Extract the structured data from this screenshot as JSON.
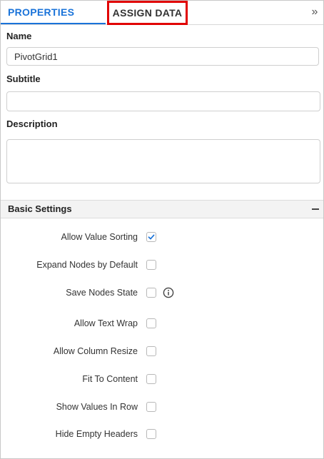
{
  "tabs": {
    "properties": "PROPERTIES",
    "assign_data": "ASSIGN DATA",
    "collapse_icon": "double-chevron-right-icon"
  },
  "fields": {
    "name_label": "Name",
    "name_value": "PivotGrid1",
    "subtitle_label": "Subtitle",
    "subtitle_value": "",
    "description_label": "Description",
    "description_value": ""
  },
  "basic_settings": {
    "title": "Basic Settings",
    "collapse_icon": "minus-icon",
    "items": [
      {
        "label": "Allow Value Sorting",
        "checked": true
      },
      {
        "label": "Expand Nodes by Default",
        "checked": false
      },
      {
        "label": "Save Nodes State",
        "checked": false,
        "info_icon": "info-icon"
      },
      {
        "label": "Allow Text Wrap",
        "checked": false
      },
      {
        "label": "Allow Column Resize",
        "checked": false
      },
      {
        "label": "Fit To Content",
        "checked": false
      },
      {
        "label": "Show Values In Row",
        "checked": false
      },
      {
        "label": "Hide Empty Headers",
        "checked": false
      }
    ]
  },
  "colors": {
    "accent": "#1a73d9",
    "highlight_border": "#e10000"
  }
}
